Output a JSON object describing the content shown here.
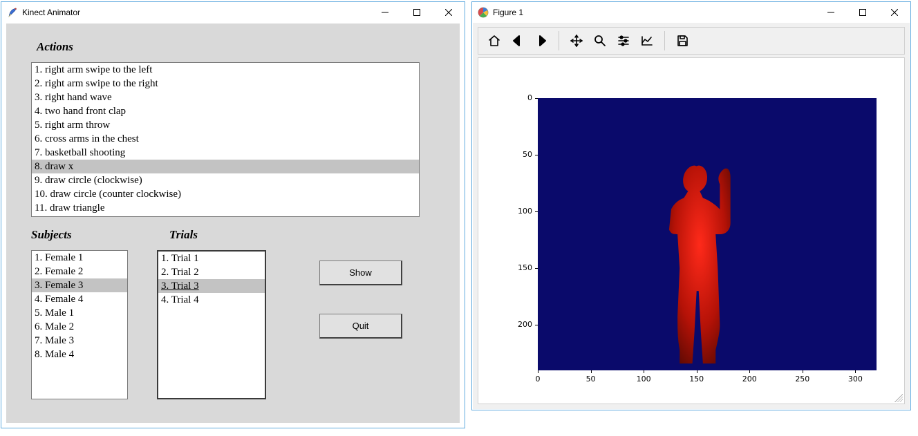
{
  "tk_window": {
    "title": "Kinect Animator",
    "labels": {
      "actions": "Actions",
      "subjects": "Subjects",
      "trials": "Trials"
    },
    "actions": [
      "1. right arm swipe to the left",
      "2. right arm swipe to the right",
      "3. right hand wave",
      "4. two hand front clap",
      "5. right arm throw",
      "6. cross arms in the chest",
      "7. basketball shooting",
      "8. draw x",
      "9. draw circle (clockwise)",
      "10. draw circle (counter clockwise)",
      "11. draw triangle"
    ],
    "actions_selected_index": 7,
    "subjects": [
      "1. Female 1",
      "2. Female 2",
      "3. Female 3",
      "4. Female 4",
      "5. Male 1",
      "6. Male 2",
      "7. Male 3",
      "8. Male 4"
    ],
    "subjects_selected_index": 2,
    "trials": [
      "1. Trial 1",
      "2. Trial 2",
      "3. Trial 3",
      "4. Trial 4"
    ],
    "trials_selected_index": 2,
    "buttons": {
      "show": "Show",
      "quit": "Quit"
    }
  },
  "fig_window": {
    "title": "Figure 1",
    "toolbar_icons": [
      "home-icon",
      "back-icon",
      "forward-icon",
      "sep",
      "pan-icon",
      "zoom-icon",
      "configure-icon",
      "edit-axis-icon",
      "sep",
      "save-icon"
    ]
  },
  "chart_data": {
    "type": "heatmap",
    "title": "",
    "xlabel": "",
    "ylabel": "",
    "xlim": [
      0,
      320
    ],
    "ylim": [
      240,
      0
    ],
    "x_ticks": [
      0,
      50,
      100,
      150,
      200,
      250,
      300
    ],
    "y_ticks": [
      0,
      50,
      100,
      150,
      200
    ],
    "description": "Kinect depth frame: dark-blue background with a red human silhouette (right arm raised) centered roughly at x≈130–170, y≈60–235.",
    "colors": {
      "background": "#0a0a6b",
      "foreground_min": "#5a0000",
      "foreground_max": "#ff0000"
    }
  }
}
